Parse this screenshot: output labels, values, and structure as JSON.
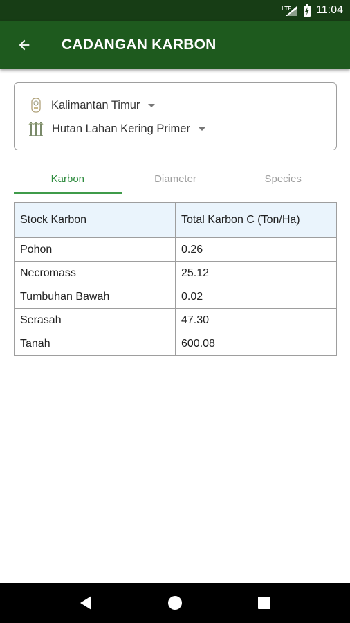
{
  "status_bar": {
    "network_label": "LTE",
    "time": "11:04",
    "icons": [
      "lte-signal-icon",
      "battery-charging-icon"
    ]
  },
  "app_bar": {
    "title": "CADANGAN KARBON",
    "back_icon": "arrow-back-icon"
  },
  "filters": {
    "province": "Kalimantan Timur",
    "province_icon": "province-emblem-icon",
    "forest_type": "Hutan Lahan Kering Primer",
    "forest_type_icon": "forest-icon"
  },
  "tabs": [
    {
      "label": "Karbon",
      "active": true
    },
    {
      "label": "Diameter",
      "active": false
    },
    {
      "label": "Species",
      "active": false
    }
  ],
  "table": {
    "headers": [
      "Stock Karbon",
      "Total Karbon C (Ton/Ha)"
    ],
    "rows": [
      [
        "Pohon",
        "0.26"
      ],
      [
        "Necromass",
        "25.12"
      ],
      [
        "Tumbuhan Bawah",
        "0.02"
      ],
      [
        "Serasah",
        "47.30"
      ],
      [
        "Tanah",
        "600.08"
      ]
    ]
  },
  "nav_bar": {
    "buttons": [
      "back-triangle-icon",
      "home-circle-icon",
      "recents-square-icon"
    ]
  },
  "colors": {
    "status_bar": "#173d15",
    "app_bar": "#1e5a1e",
    "tab_active": "#2e8b3e",
    "table_header_bg": "#eaf4fc"
  }
}
